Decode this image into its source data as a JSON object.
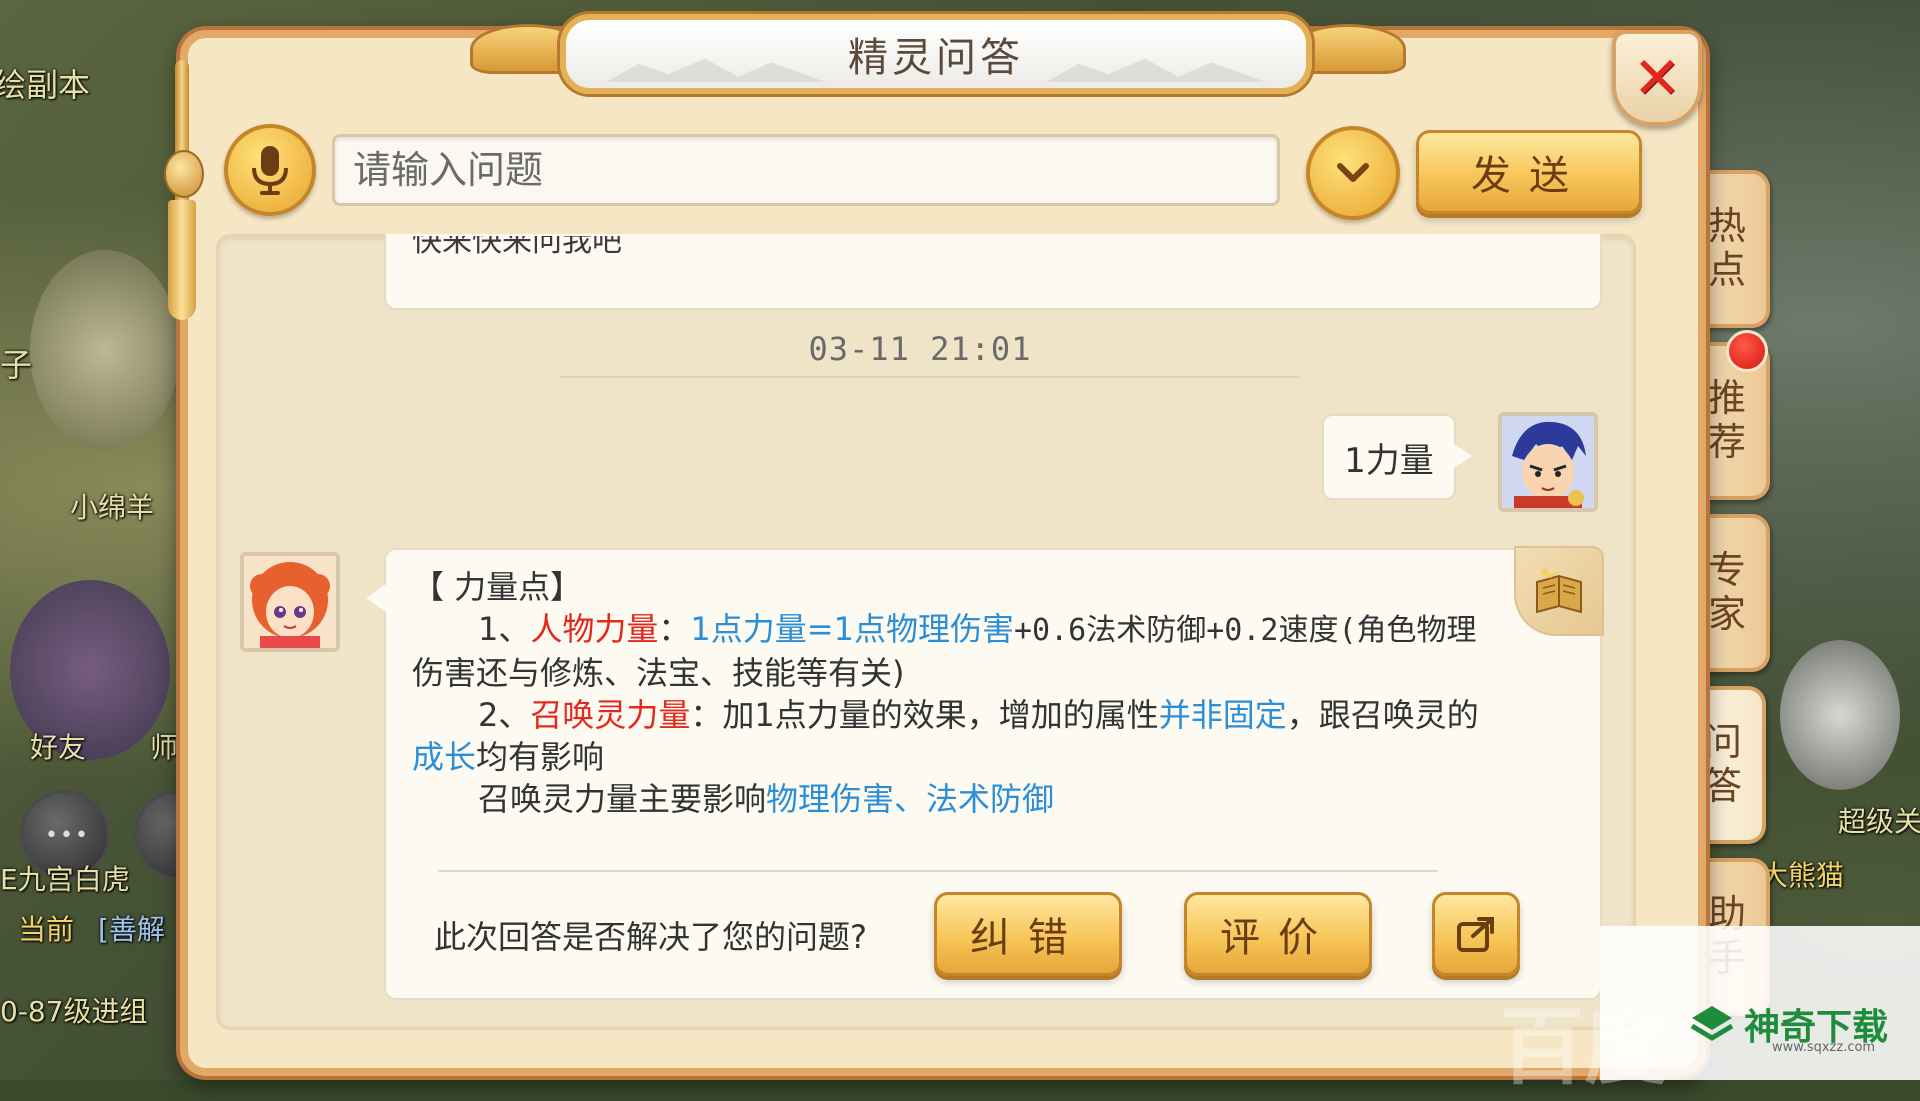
{
  "window": {
    "title": "精灵问答"
  },
  "background": {
    "top_left_label": "绘副本",
    "side_name": "小绵羊",
    "side_letter": "子",
    "friend_label": "好友",
    "teacher_label": "师",
    "channel_current": "当前",
    "channel_tag": "[善解",
    "bottom_left_text": "E九宫白虎",
    "level_text": "0-87级进组",
    "right_label_1": "超级关",
    "right_label_2": "大熊猫"
  },
  "input": {
    "placeholder": "请输入问题",
    "value": "",
    "send_label": "发送"
  },
  "tabs": [
    {
      "label_1": "热",
      "label_2": "点"
    },
    {
      "label_1": "推",
      "label_2": "荐"
    },
    {
      "label_1": "专",
      "label_2": "家"
    },
    {
      "label_1": "问",
      "label_2": "答"
    },
    {
      "label_1": "助",
      "label_2": "手"
    }
  ],
  "chat": {
    "prev_fragment": "快来快来问我吧",
    "timestamp": "03-11 21:01",
    "user_message": "1力量",
    "answer": {
      "heading": "【 力量点】",
      "l1_prefix": "1、",
      "l1_red": "人物力量",
      "l1_colon": "：",
      "l1_blue": "1点力量=1点物理伤害",
      "l1_rest": "+0.6法术防御+0.2速度(角色物理",
      "l1_cont": "伤害还与修炼、法宝、技能等有关)",
      "l2_prefix": "2、",
      "l2_red": "召唤灵力量",
      "l2_text": "：加1点力量的效果，增加的属性",
      "l2_blue": "并非固定",
      "l2_rest": "，跟召唤灵的",
      "l2_cont_blue": "成长",
      "l2_cont_rest": "均有影响",
      "l3_text": "召唤灵力量主要影响",
      "l3_blue": "物理伤害、法术防御"
    },
    "feedback": {
      "question": "此次回答是否解决了您的问题?",
      "correct_label": "纠错",
      "rate_label": "评价"
    }
  },
  "watermark": {
    "brand": "神奇下载",
    "url": "www.sqxzz.com",
    "faint": "百度"
  },
  "colors": {
    "accent_red": "#e3291e",
    "accent_blue": "#2b8fd8",
    "button_gold": "#f7c659",
    "panel_bg": "#f6e6c4"
  },
  "icons": [
    "microphone-icon",
    "chevron-down-icon",
    "close-icon",
    "book-icon",
    "share-icon"
  ]
}
